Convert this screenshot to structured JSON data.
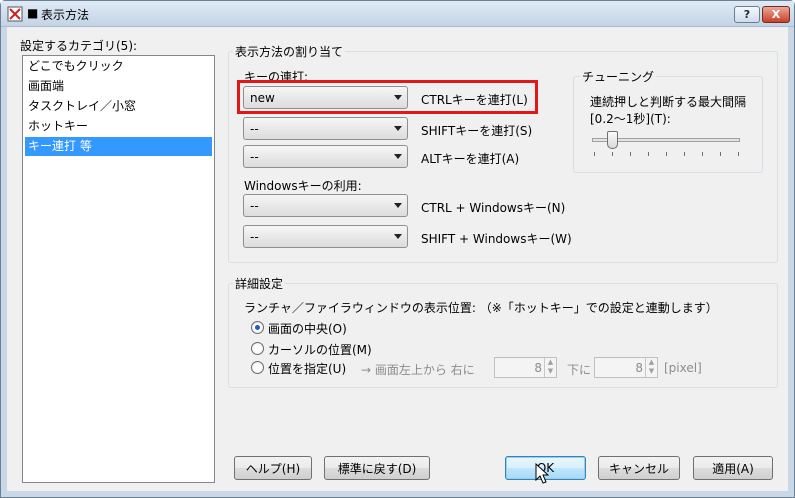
{
  "window": {
    "title_prefix": "■",
    "title": "表示方法",
    "help_glyph": "?",
    "close_glyph": "X"
  },
  "categories": {
    "label": "設定するカテゴリ(5):",
    "items": [
      "どこでもクリック",
      "画面端",
      "タスクトレイ／小窓",
      "ホットキー",
      "キー連打 等"
    ],
    "selected_index": 4
  },
  "display": {
    "group_title": "表示方法の割り当て",
    "key_repeat_label": "キーの連打:",
    "rows": [
      {
        "value": "new",
        "label": "CTRLキーを連打(L)"
      },
      {
        "value": "--",
        "label": "SHIFTキーを連打(S)"
      },
      {
        "value": "--",
        "label": "ALTキーを連打(A)"
      }
    ],
    "windows_label": "Windowsキーの利用:",
    "win_rows": [
      {
        "value": "--",
        "label": "CTRL + Windowsキー(N)"
      },
      {
        "value": "--",
        "label": "SHIFT + Windowsキー(W)"
      }
    ]
  },
  "tuning": {
    "title": "チューニング",
    "label_line1": "連続押しと判断する最大間隔",
    "label_line2": "[0.2～1秒](T):",
    "slider_value": 0.2
  },
  "detail": {
    "title": "詳細設定",
    "desc": "ランチャ／ファイラウィンドウの表示位置:  （※「ホットキー」での設定と連動します）",
    "options": [
      "画面の中央(O)",
      "カーソルの位置(M)",
      "位置を指定(U)"
    ],
    "selected_option": 0,
    "position_text": "→  画面左上から  右に",
    "right_value": "8",
    "down_label": "下に",
    "down_value": "8",
    "unit": "[pixel]"
  },
  "buttons": {
    "help": "ヘルプ(H)",
    "reset": "標準に戻す(D)",
    "ok": "OK",
    "cancel": "キャンセル",
    "apply": "適用(A)"
  }
}
